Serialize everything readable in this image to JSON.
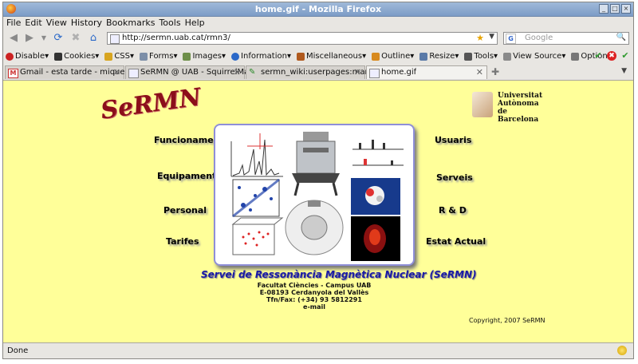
{
  "window": {
    "title": "home.gif - Mozilla Firefox"
  },
  "menu": [
    "File",
    "Edit",
    "View",
    "History",
    "Bookmarks",
    "Tools",
    "Help"
  ],
  "navbar": {
    "url": "http://sermn.uab.cat/rmn3/",
    "search_placeholder": "Google"
  },
  "devtoolbar": {
    "items": [
      "Disable",
      "Cookies",
      "CSS",
      "Forms",
      "Images",
      "Information",
      "Miscellaneous",
      "Outline",
      "Resize",
      "Tools",
      "View Source",
      "Options"
    ]
  },
  "tabs": [
    {
      "label": "Gmail - esta tarde - miquel....",
      "active": false
    },
    {
      "label": "SeRMN @ UAB - SquirrelMa...",
      "active": false
    },
    {
      "label": "sermn_wiki:userpages:mart...",
      "active": false
    },
    {
      "label": "home.gif",
      "active": true
    }
  ],
  "page": {
    "logo_text": "SeRMN",
    "uab_lines": [
      "Universitat",
      "Autònoma",
      "de Barcelona"
    ],
    "nav_left": [
      "Funcionament",
      "Equipaments",
      "Personal",
      "Tarifes"
    ],
    "nav_right": [
      "Usuaris",
      "Serveis",
      "R & D",
      "Estat Actual"
    ],
    "caption": "Servei de Ressonància Magnètica Nuclear (SeRMN)",
    "address": [
      "Facultat Ciències - Campus UAB",
      "E-08193 Cerdanyola del Vallès",
      "Tfn/Fax: (+34) 93 5812291",
      "e-mail"
    ],
    "copyright": "Copyright, 2007 SeRMN"
  },
  "status": {
    "text": "Done"
  },
  "colors": {
    "page_bg": "#ffff99",
    "caption": "#1a1aa6",
    "logo": "#8b0f1a"
  }
}
